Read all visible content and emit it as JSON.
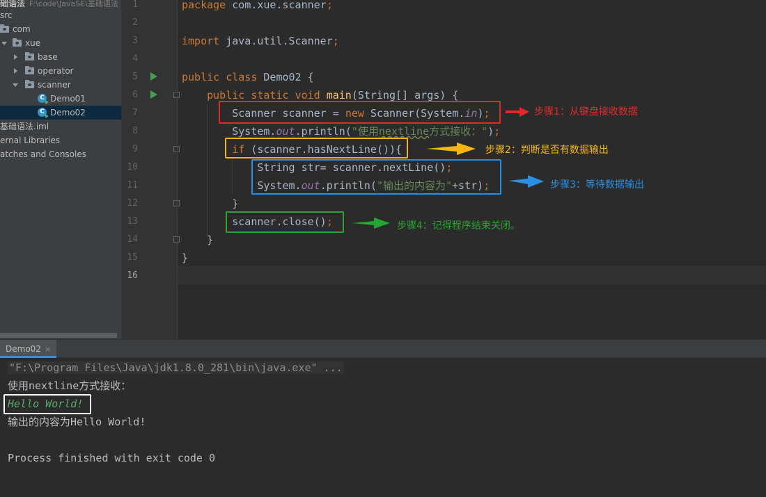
{
  "project_tree": {
    "root": {
      "name": "础语法",
      "path": "F:\\code\\JavaSE\\基础语法"
    },
    "items": [
      {
        "label": "src"
      },
      {
        "label": "com"
      },
      {
        "label": "xue"
      },
      {
        "label": "base"
      },
      {
        "label": "operator"
      },
      {
        "label": "scanner"
      },
      {
        "label": "Demo01"
      },
      {
        "label": "Demo02"
      },
      {
        "label": "基础语法.iml"
      },
      {
        "label": "ernal Libraries"
      },
      {
        "label": "atches and Consoles"
      }
    ]
  },
  "editor": {
    "line_numbers": [
      "1",
      "2",
      "3",
      "4",
      "5",
      "6",
      "7",
      "8",
      "9",
      "10",
      "11",
      "12",
      "13",
      "14",
      "15",
      "16"
    ],
    "lines": {
      "l1": {
        "kw": "package",
        "rest": " com.xue.scanner",
        "semi": ";"
      },
      "l3": {
        "kw": "import",
        "rest": " java.util.Scanner",
        "semi": ";"
      },
      "l5": {
        "kw1": "public",
        "kw2": "class",
        "rest": " Demo02 {"
      },
      "l6": {
        "kw1": "public",
        "kw2": "static",
        "kw3": "void",
        "fn": "main",
        "rest": "(String[] args) {"
      },
      "l7": {
        "a": "Scanner scanner = ",
        "kw": "new",
        "b": " Scanner(System.",
        "fld": "in",
        "c": ")",
        "semi": ";"
      },
      "l8": {
        "a": "System.",
        "fld": "out",
        "b": ".println(",
        "str1": "\"使用",
        "str2": "nextline",
        "str3": "方式接收：\"",
        "c": ")",
        "semi": ";"
      },
      "l9": {
        "kw": "if",
        "rest": " (scanner.hasNextLine()){"
      },
      "l10": {
        "a": "String str= scanner.nextLine()",
        "semi": ";"
      },
      "l11": {
        "a": "System.",
        "fld": "out",
        "b": ".println(",
        "str": "\"输出的内容为\"",
        "c": "+str)",
        "semi": ";"
      },
      "l12": {
        "a": "}"
      },
      "l13": {
        "a": "scanner.close()",
        "semi": ";"
      },
      "l14": {
        "a": "}"
      },
      "l15": {
        "a": "}"
      }
    }
  },
  "annotations": [
    {
      "label": "步骤1：从键盘接收数据",
      "color": "#e5282a"
    },
    {
      "label": "步骤2：判断是否有数据输出",
      "color": "#f5b70f"
    },
    {
      "label": "步骤3：等待数据输出",
      "color": "#2a8fe3"
    },
    {
      "label": "步骤4：记得程序结束关闭。",
      "color": "#24a732"
    }
  ],
  "run_panel": {
    "tab_label": "Demo02",
    "tab_close": "×",
    "console": {
      "command": "\"F:\\Program Files\\Java\\jdk1.8.0_281\\bin\\java.exe\" ...",
      "line2": "使用nextline方式接收：",
      "input": "Hello World!",
      "line4": "输出的内容为Hello World!",
      "line6": "Process finished with exit code 0"
    }
  }
}
